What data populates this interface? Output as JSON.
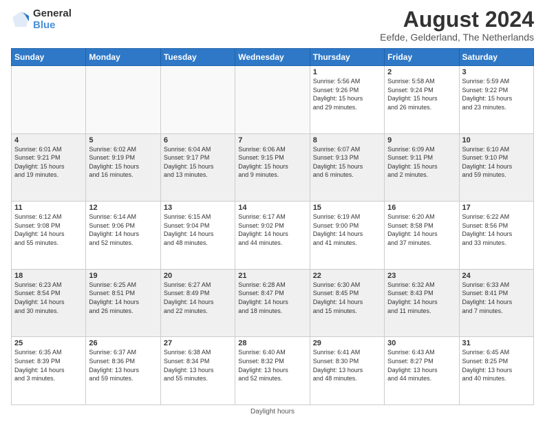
{
  "header": {
    "logo_line1": "General",
    "logo_line2": "Blue",
    "month": "August 2024",
    "location": "Eefde, Gelderland, The Netherlands"
  },
  "days_of_week": [
    "Sunday",
    "Monday",
    "Tuesday",
    "Wednesday",
    "Thursday",
    "Friday",
    "Saturday"
  ],
  "footer": "Daylight hours",
  "weeks": [
    [
      {
        "day": "",
        "info": ""
      },
      {
        "day": "",
        "info": ""
      },
      {
        "day": "",
        "info": ""
      },
      {
        "day": "",
        "info": ""
      },
      {
        "day": "1",
        "info": "Sunrise: 5:56 AM\nSunset: 9:26 PM\nDaylight: 15 hours\nand 29 minutes."
      },
      {
        "day": "2",
        "info": "Sunrise: 5:58 AM\nSunset: 9:24 PM\nDaylight: 15 hours\nand 26 minutes."
      },
      {
        "day": "3",
        "info": "Sunrise: 5:59 AM\nSunset: 9:22 PM\nDaylight: 15 hours\nand 23 minutes."
      }
    ],
    [
      {
        "day": "4",
        "info": "Sunrise: 6:01 AM\nSunset: 9:21 PM\nDaylight: 15 hours\nand 19 minutes."
      },
      {
        "day": "5",
        "info": "Sunrise: 6:02 AM\nSunset: 9:19 PM\nDaylight: 15 hours\nand 16 minutes."
      },
      {
        "day": "6",
        "info": "Sunrise: 6:04 AM\nSunset: 9:17 PM\nDaylight: 15 hours\nand 13 minutes."
      },
      {
        "day": "7",
        "info": "Sunrise: 6:06 AM\nSunset: 9:15 PM\nDaylight: 15 hours\nand 9 minutes."
      },
      {
        "day": "8",
        "info": "Sunrise: 6:07 AM\nSunset: 9:13 PM\nDaylight: 15 hours\nand 6 minutes."
      },
      {
        "day": "9",
        "info": "Sunrise: 6:09 AM\nSunset: 9:11 PM\nDaylight: 15 hours\nand 2 minutes."
      },
      {
        "day": "10",
        "info": "Sunrise: 6:10 AM\nSunset: 9:10 PM\nDaylight: 14 hours\nand 59 minutes."
      }
    ],
    [
      {
        "day": "11",
        "info": "Sunrise: 6:12 AM\nSunset: 9:08 PM\nDaylight: 14 hours\nand 55 minutes."
      },
      {
        "day": "12",
        "info": "Sunrise: 6:14 AM\nSunset: 9:06 PM\nDaylight: 14 hours\nand 52 minutes."
      },
      {
        "day": "13",
        "info": "Sunrise: 6:15 AM\nSunset: 9:04 PM\nDaylight: 14 hours\nand 48 minutes."
      },
      {
        "day": "14",
        "info": "Sunrise: 6:17 AM\nSunset: 9:02 PM\nDaylight: 14 hours\nand 44 minutes."
      },
      {
        "day": "15",
        "info": "Sunrise: 6:19 AM\nSunset: 9:00 PM\nDaylight: 14 hours\nand 41 minutes."
      },
      {
        "day": "16",
        "info": "Sunrise: 6:20 AM\nSunset: 8:58 PM\nDaylight: 14 hours\nand 37 minutes."
      },
      {
        "day": "17",
        "info": "Sunrise: 6:22 AM\nSunset: 8:56 PM\nDaylight: 14 hours\nand 33 minutes."
      }
    ],
    [
      {
        "day": "18",
        "info": "Sunrise: 6:23 AM\nSunset: 8:54 PM\nDaylight: 14 hours\nand 30 minutes."
      },
      {
        "day": "19",
        "info": "Sunrise: 6:25 AM\nSunset: 8:51 PM\nDaylight: 14 hours\nand 26 minutes."
      },
      {
        "day": "20",
        "info": "Sunrise: 6:27 AM\nSunset: 8:49 PM\nDaylight: 14 hours\nand 22 minutes."
      },
      {
        "day": "21",
        "info": "Sunrise: 6:28 AM\nSunset: 8:47 PM\nDaylight: 14 hours\nand 18 minutes."
      },
      {
        "day": "22",
        "info": "Sunrise: 6:30 AM\nSunset: 8:45 PM\nDaylight: 14 hours\nand 15 minutes."
      },
      {
        "day": "23",
        "info": "Sunrise: 6:32 AM\nSunset: 8:43 PM\nDaylight: 14 hours\nand 11 minutes."
      },
      {
        "day": "24",
        "info": "Sunrise: 6:33 AM\nSunset: 8:41 PM\nDaylight: 14 hours\nand 7 minutes."
      }
    ],
    [
      {
        "day": "25",
        "info": "Sunrise: 6:35 AM\nSunset: 8:39 PM\nDaylight: 14 hours\nand 3 minutes."
      },
      {
        "day": "26",
        "info": "Sunrise: 6:37 AM\nSunset: 8:36 PM\nDaylight: 13 hours\nand 59 minutes."
      },
      {
        "day": "27",
        "info": "Sunrise: 6:38 AM\nSunset: 8:34 PM\nDaylight: 13 hours\nand 55 minutes."
      },
      {
        "day": "28",
        "info": "Sunrise: 6:40 AM\nSunset: 8:32 PM\nDaylight: 13 hours\nand 52 minutes."
      },
      {
        "day": "29",
        "info": "Sunrise: 6:41 AM\nSunset: 8:30 PM\nDaylight: 13 hours\nand 48 minutes."
      },
      {
        "day": "30",
        "info": "Sunrise: 6:43 AM\nSunset: 8:27 PM\nDaylight: 13 hours\nand 44 minutes."
      },
      {
        "day": "31",
        "info": "Sunrise: 6:45 AM\nSunset: 8:25 PM\nDaylight: 13 hours\nand 40 minutes."
      }
    ]
  ]
}
